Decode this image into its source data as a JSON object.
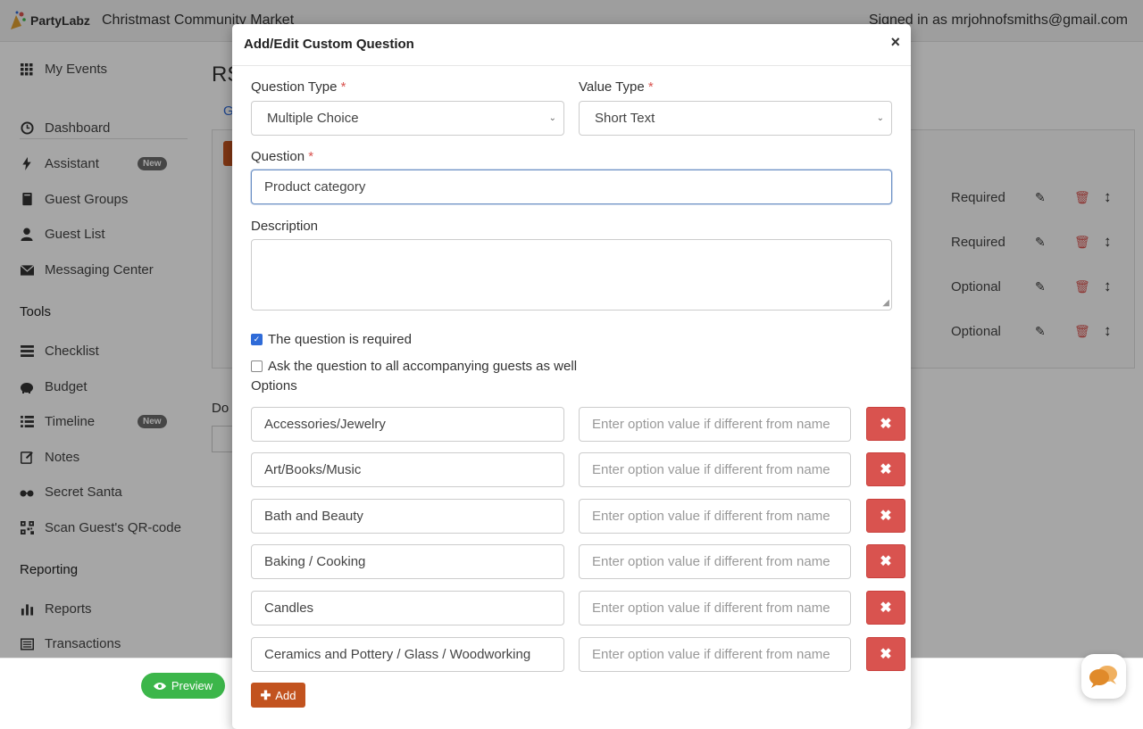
{
  "header": {
    "logo_text": "PartyLabz",
    "event_title": "Christmast Community Market",
    "signed_in": "Signed in as mrjohnofsmiths@gmail.com"
  },
  "sidebar": {
    "items": [
      {
        "label": "My Events",
        "icon": "grid-icon"
      },
      {
        "label": "Dashboard",
        "icon": "clock-icon"
      },
      {
        "label": "Assistant",
        "icon": "bolt-icon",
        "badge": "New"
      },
      {
        "label": "Guest Groups",
        "icon": "book-icon"
      },
      {
        "label": "Guest List",
        "icon": "user-icon"
      },
      {
        "label": "Messaging Center",
        "icon": "envelope-icon"
      }
    ],
    "tools_title": "Tools",
    "tools": [
      {
        "label": "Checklist",
        "icon": "checklist-icon"
      },
      {
        "label": "Budget",
        "icon": "piggy-bank-icon"
      },
      {
        "label": "Timeline",
        "icon": "list-icon",
        "badge": "New"
      },
      {
        "label": "Notes",
        "icon": "edit-icon"
      },
      {
        "label": "Secret Santa",
        "icon": "glasses-icon"
      },
      {
        "label": "Scan Guest's QR-code",
        "icon": "qr-icon"
      }
    ],
    "reporting_title": "Reporting",
    "reporting": [
      {
        "label": "Reports",
        "icon": "bar-chart-icon"
      },
      {
        "label": "Transactions",
        "icon": "table-icon"
      }
    ]
  },
  "background": {
    "page_title": "RS",
    "tab_partial": "G",
    "do_text": "Do",
    "rows": [
      {
        "status": "Required"
      },
      {
        "status": "Required"
      },
      {
        "status": "Optional"
      },
      {
        "status": "Optional"
      }
    ]
  },
  "modal": {
    "title": "Add/Edit Custom Question",
    "close": "×",
    "question_type_label": "Question Type",
    "question_type_value": "Multiple Choice",
    "value_type_label": "Value Type",
    "value_type_value": "Short Text",
    "required_mark": "*",
    "question_label": "Question",
    "question_value": "Product category",
    "description_label": "Description",
    "required_checkbox_label": "The question is required",
    "accompanying_checkbox_label": "Ask the question to all accompanying guests as well",
    "options_label": "Options",
    "value_placeholder": "Enter option value if different from name",
    "options": [
      "Accessories/Jewelry",
      "Art/Books/Music",
      "Bath and Beauty",
      "Baking / Cooking",
      "Candles",
      "Ceramics and Pottery / Glass / Woodworking"
    ],
    "add_label": "Add"
  },
  "footer": {
    "preview_label": "Preview"
  },
  "colors": {
    "accent_orange": "#c2531f",
    "danger": "#d9534f",
    "success": "#3cb64a"
  }
}
